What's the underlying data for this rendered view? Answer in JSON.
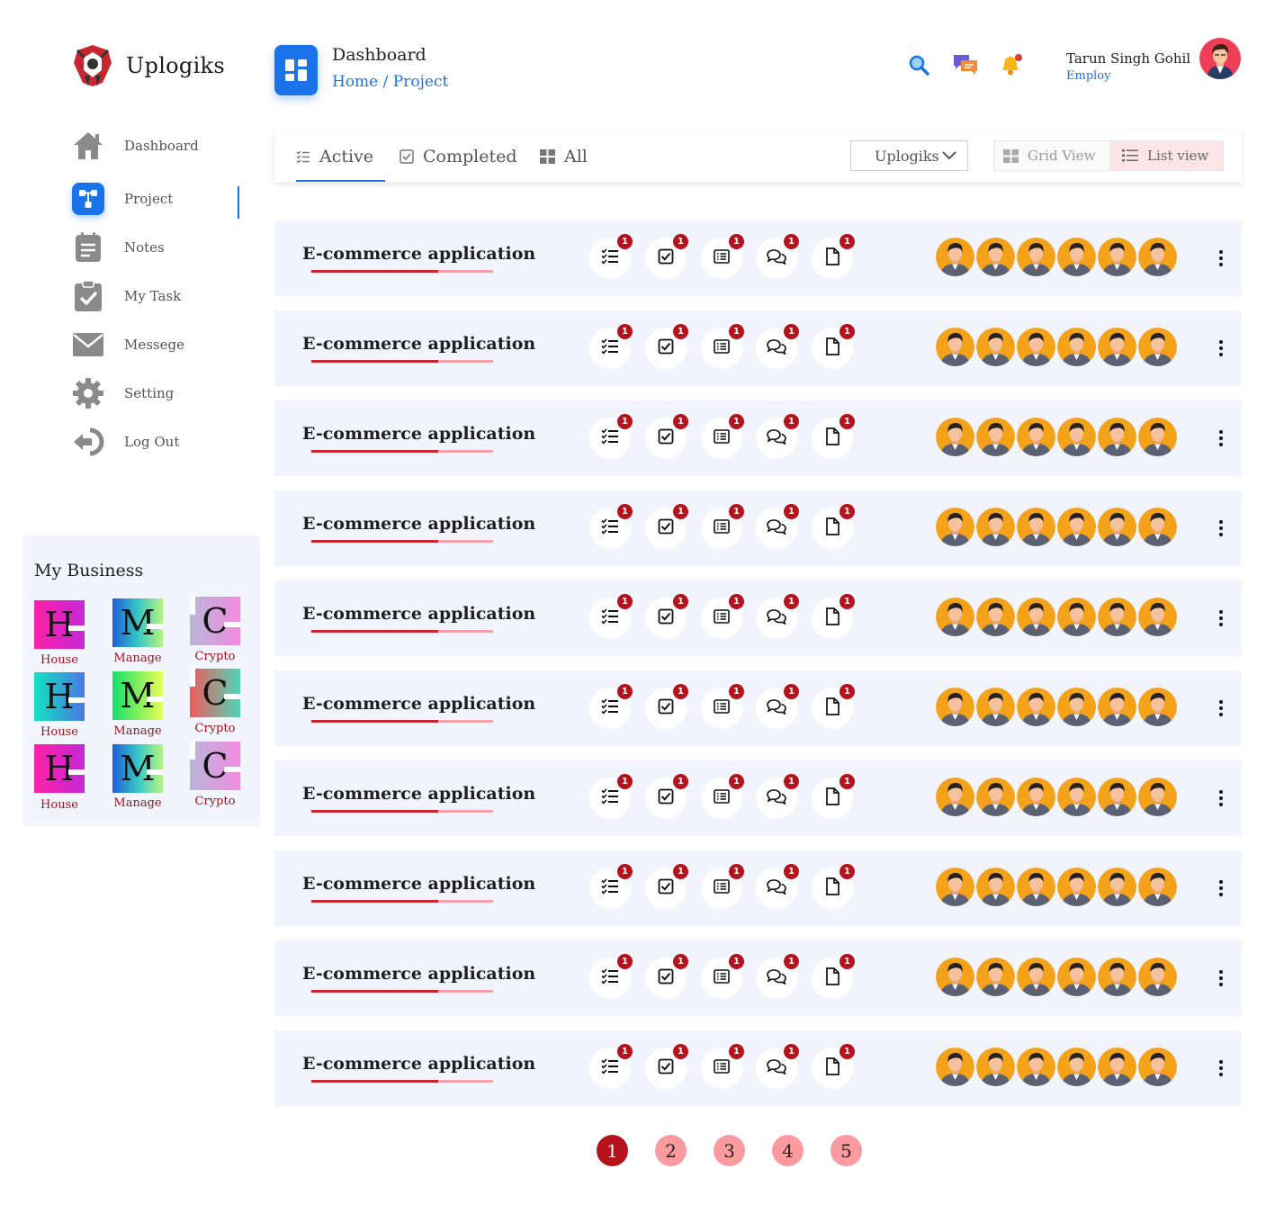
{
  "brand": {
    "name": "Uplogiks"
  },
  "sidebar": {
    "items": [
      {
        "label": "Dashboard",
        "icon": "home-icon"
      },
      {
        "label": "Project",
        "icon": "project-icon",
        "active": true
      },
      {
        "label": "Notes",
        "icon": "notes-icon"
      },
      {
        "label": "My Task",
        "icon": "clipboard-check-icon"
      },
      {
        "label": "Messege",
        "icon": "envelope-icon"
      },
      {
        "label": "Setting",
        "icon": "gear-icon"
      },
      {
        "label": "Log Out",
        "icon": "logout-icon"
      }
    ]
  },
  "business": {
    "title": "My Business",
    "tiles": [
      {
        "letter": "H",
        "label": "House"
      },
      {
        "letter": "M",
        "label": "Manage"
      },
      {
        "letter": "C",
        "label": "Crypto"
      },
      {
        "letter": "H",
        "label": "House"
      },
      {
        "letter": "M",
        "label": "Manage"
      },
      {
        "letter": "C",
        "label": "Crypto"
      },
      {
        "letter": "H",
        "label": "House"
      },
      {
        "letter": "M",
        "label": "Manage"
      },
      {
        "letter": "C",
        "label": "Crypto"
      }
    ]
  },
  "header": {
    "title": "Dashboard",
    "breadcrumb": {
      "home": "Home",
      "separator": "/",
      "current": "Project"
    },
    "tools": [
      "search-icon",
      "chat-icon",
      "bell-icon"
    ]
  },
  "user": {
    "name": "Tarun Singh Gohil",
    "role": "Employ"
  },
  "tabs": [
    {
      "label": "Active",
      "icon": "checklist-icon",
      "active": true
    },
    {
      "label": "Completed",
      "icon": "checkbox-icon"
    },
    {
      "label": "All",
      "icon": "grid-icon"
    }
  ],
  "filter": {
    "selected": "Uplogiks"
  },
  "views": {
    "grid": "Grid View",
    "list": "List view",
    "active": "list"
  },
  "projects": [
    {
      "name": "E-commerce application",
      "progress": 0.7,
      "counts": [
        1,
        1,
        1,
        1,
        1
      ],
      "members": 6
    },
    {
      "name": "E-commerce application",
      "progress": 0.7,
      "counts": [
        1,
        1,
        1,
        1,
        1
      ],
      "members": 6
    },
    {
      "name": "E-commerce application",
      "progress": 0.7,
      "counts": [
        1,
        1,
        1,
        1,
        1
      ],
      "members": 6
    },
    {
      "name": "E-commerce application",
      "progress": 0.7,
      "counts": [
        1,
        1,
        1,
        1,
        1
      ],
      "members": 6
    },
    {
      "name": "E-commerce application",
      "progress": 0.7,
      "counts": [
        1,
        1,
        1,
        1,
        1
      ],
      "members": 6
    },
    {
      "name": "E-commerce application",
      "progress": 0.7,
      "counts": [
        1,
        1,
        1,
        1,
        1
      ],
      "members": 6
    },
    {
      "name": "E-commerce application",
      "progress": 0.7,
      "counts": [
        1,
        1,
        1,
        1,
        1
      ],
      "members": 6
    },
    {
      "name": "E-commerce application",
      "progress": 0.7,
      "counts": [
        1,
        1,
        1,
        1,
        1
      ],
      "members": 6
    },
    {
      "name": "E-commerce application",
      "progress": 0.7,
      "counts": [
        1,
        1,
        1,
        1,
        1
      ],
      "members": 6
    },
    {
      "name": "E-commerce application",
      "progress": 0.7,
      "counts": [
        1,
        1,
        1,
        1,
        1
      ],
      "members": 6
    }
  ],
  "row_actions": [
    "task-list-icon",
    "checkbox-icon",
    "list-icon",
    "comments-icon",
    "file-icon"
  ],
  "pagination": {
    "pages": [
      "1",
      "2",
      "3",
      "4",
      "5"
    ],
    "current": "1"
  },
  "colors": {
    "primary": "#1a73e8",
    "accent": "#b5121b",
    "row_bg": "#f1f4fd",
    "page": "#fb9b9f"
  }
}
